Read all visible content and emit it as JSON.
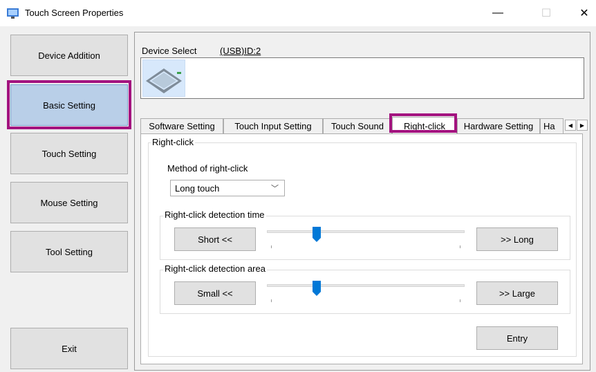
{
  "window": {
    "title": "Touch Screen Properties",
    "minimize_glyph": "—",
    "maximize_glyph": "☐",
    "close_glyph": "✕"
  },
  "nav": {
    "items": [
      {
        "label": "Device Addition"
      },
      {
        "label": "Basic Setting"
      },
      {
        "label": "Touch Setting"
      },
      {
        "label": "Mouse Setting"
      },
      {
        "label": "Tool Setting"
      }
    ],
    "exit_label": "Exit",
    "selected": "Basic Setting"
  },
  "device": {
    "select_label": "Device Select",
    "id": "(USB)ID:2"
  },
  "tabs": [
    {
      "label": "Software Setting"
    },
    {
      "label": "Touch Input Setting"
    },
    {
      "label": "Touch Sound"
    },
    {
      "label": "Right-click"
    },
    {
      "label": "Hardware Setting"
    },
    {
      "label": "Ha"
    }
  ],
  "active_tab": "Right-click",
  "right_click": {
    "group_title": "Right-click",
    "method_label": "Method of right-click",
    "method_value": "Long touch",
    "detection_time": {
      "title": "Right-click detection time",
      "min_label": "Short <<",
      "max_label": ">> Long",
      "level": 0.24
    },
    "detection_area": {
      "title": "Right-click detection area",
      "min_label": "Small <<",
      "max_label": ">> Large",
      "level": 0.24
    },
    "entry_label": "Entry"
  },
  "colors": {
    "highlight": "#a3137f",
    "selected_nav": "#b9cfe8",
    "slider_thumb": "#0078d7"
  }
}
